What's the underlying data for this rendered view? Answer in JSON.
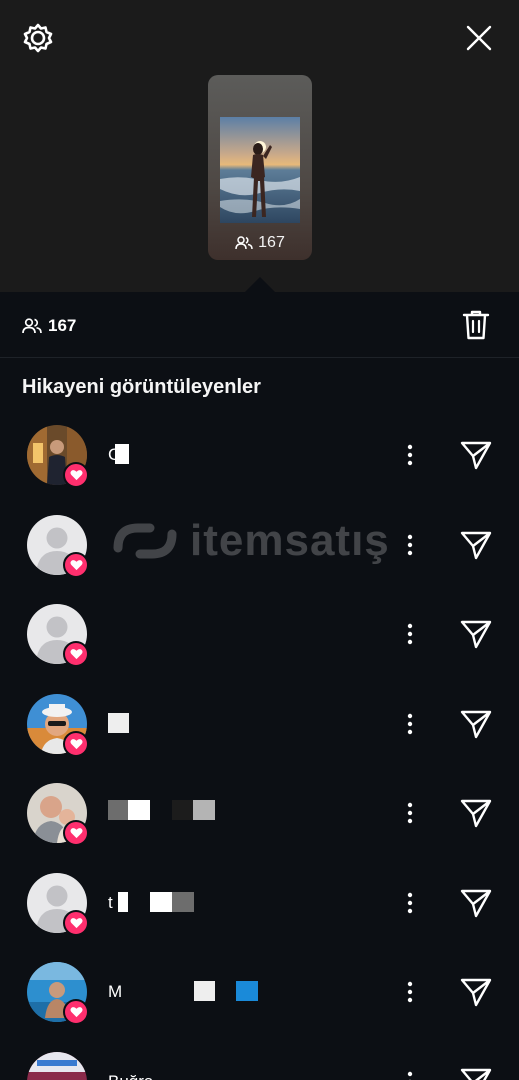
{
  "header": {
    "settings_icon": "gear-icon",
    "close_icon": "close-icon"
  },
  "story": {
    "viewer_count": "167"
  },
  "stats": {
    "viewer_count": "167",
    "delete_icon": "trash-icon"
  },
  "section_title": "Hikayeni görüntüleyenler",
  "viewers": [
    {
      "name": "C",
      "avatar": "photo",
      "liked": true
    },
    {
      "name": "",
      "avatar": "default",
      "liked": true
    },
    {
      "name": "",
      "avatar": "default",
      "liked": true
    },
    {
      "name": "",
      "avatar": "photo",
      "liked": true
    },
    {
      "name": "",
      "avatar": "photo",
      "liked": true
    },
    {
      "name": "t",
      "avatar": "default",
      "liked": true
    },
    {
      "name": "M",
      "avatar": "photo",
      "liked": true
    },
    {
      "name": "Buğra",
      "avatar": "photo",
      "liked": false
    }
  ],
  "watermark": "itemsatış",
  "colors": {
    "like_badge": "#ff2f6e",
    "background": "#0c0f14",
    "header_background": "#1b1b1b"
  }
}
